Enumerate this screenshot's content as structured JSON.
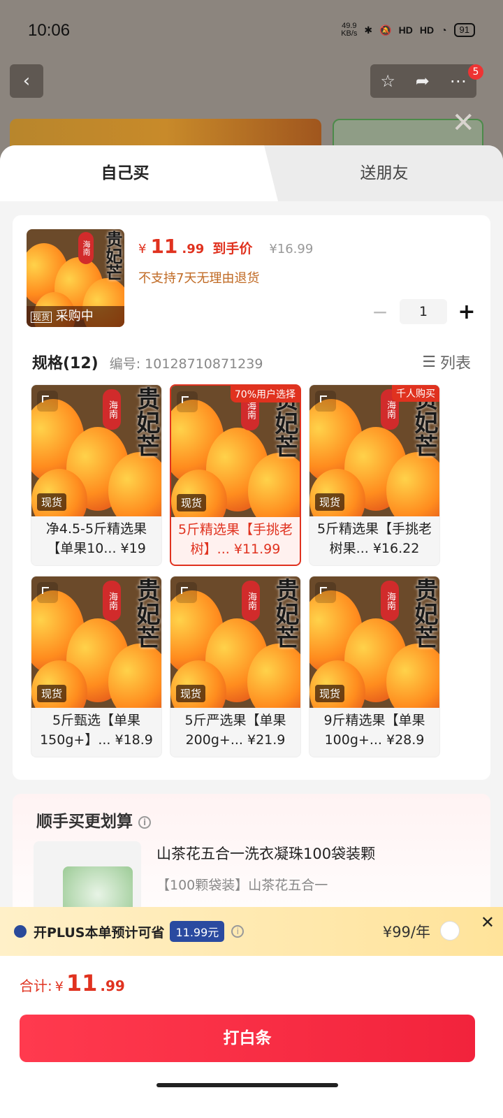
{
  "status": {
    "time": "10:06",
    "net_speed": "49.9\nKB/s",
    "signal1": "HD",
    "signal2": "HD",
    "battery": "91"
  },
  "nav": {
    "badge": "5"
  },
  "tabs": {
    "self": "自己买",
    "gift": "送朋友"
  },
  "product": {
    "stock_tag": "现货",
    "buying_tag": "采购中",
    "price_symbol": "¥",
    "price_int": "11",
    "price_dec": ".99",
    "price_tag": "到手价",
    "original_price": "¥16.99",
    "no_return": "不支持7天无理由退货",
    "quantity": "1",
    "seal": "海南",
    "calligraphy": "贵妃芒"
  },
  "spec": {
    "title": "规格(12)",
    "code": "编号: 10128710871239",
    "list_toggle": "列表"
  },
  "skus": [
    {
      "label": "净4.5-5斤精选果【单果10... ¥19",
      "badge": "",
      "selected": false
    },
    {
      "label": "5斤精选果【手挑老树】... ¥11.99",
      "badge": "70%用户选择",
      "selected": true
    },
    {
      "label": "5斤精选果【手挑老树果... ¥16.22",
      "badge": "千人购买",
      "selected": false
    },
    {
      "label": "5斤甄选【单果150g+】... ¥18.9",
      "badge": "",
      "selected": false
    },
    {
      "label": "5斤严选果【单果200g+... ¥21.9",
      "badge": "",
      "selected": false
    },
    {
      "label": "9斤精选果【单果100g+... ¥28.9",
      "badge": "",
      "selected": false
    }
  ],
  "addon": {
    "title": "顺手买更划算",
    "name": "山茶花五合一洗衣凝珠100袋装颗",
    "spec": "【100颗袋装】山茶花五合一"
  },
  "plus": {
    "text": "开PLUS本单预计可省",
    "save": "11.99元",
    "price": "¥99/年"
  },
  "bottom": {
    "total_label": "合计:",
    "total_sym": "¥",
    "total_int": "11",
    "total_dec": ".99",
    "cta": "打白条"
  },
  "colors": {
    "accent": "#e0321f",
    "cta": "#f2233c",
    "plus_badge": "#2a4aa0"
  }
}
